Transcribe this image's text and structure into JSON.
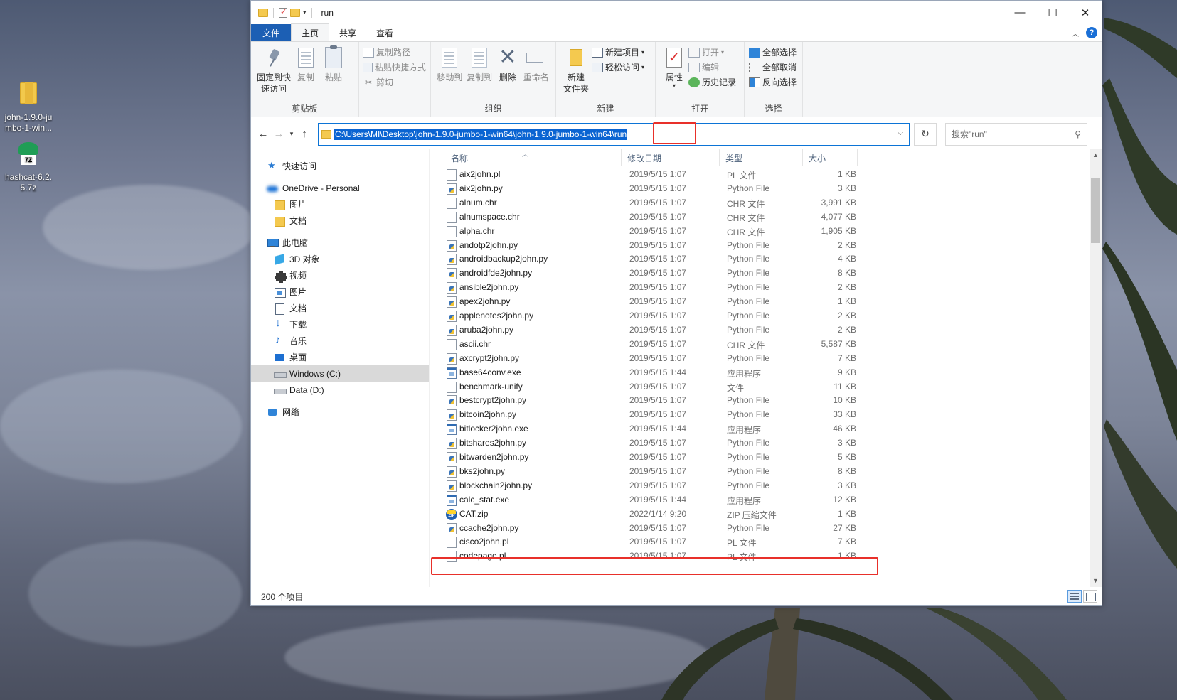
{
  "desktop": {
    "icons": [
      {
        "label": "john-1.9.0-jumbo-1-win...",
        "label_display": "john-1.9.0-ju\nmbo-1-win...",
        "icon": "folder-zip-icon"
      },
      {
        "label": "hashcat-6.2.5.7z",
        "label_display": "hashcat-6.2.\n5.7z",
        "icon": "7z-archive-icon"
      }
    ]
  },
  "window": {
    "title": "run",
    "controls": {
      "minimize": "—",
      "maximize": "☐",
      "close": "✕"
    }
  },
  "tabs": [
    {
      "label": "文件",
      "kind": "file"
    },
    {
      "label": "主页",
      "kind": "active"
    },
    {
      "label": "共享",
      "kind": "normal"
    },
    {
      "label": "查看",
      "kind": "normal"
    }
  ],
  "ribbon": {
    "clipboard": {
      "label": "剪贴板",
      "pin": "固定到快\n速访问",
      "copy": "复制",
      "paste": "粘贴",
      "copy_path": "复制路径",
      "paste_shortcut": "粘贴快捷方式",
      "cut": "剪切"
    },
    "organize": {
      "label": "组织",
      "move_to": "移动到",
      "copy_to": "复制到",
      "delete": "删除",
      "rename": "重命名"
    },
    "new": {
      "label": "新建",
      "new_folder": "新建\n文件夹",
      "new_item": "新建项目",
      "easy_access": "轻松访问"
    },
    "open": {
      "label": "打开",
      "properties": "属性",
      "open": "打开",
      "edit": "编辑",
      "history": "历史记录"
    },
    "select": {
      "label": "选择",
      "select_all": "全部选择",
      "select_none": "全部取消",
      "invert": "反向选择"
    }
  },
  "address": {
    "path_selected": "C:\\Users\\MI\\Desktop\\john-1.9.0-jumbo-1-win64\\john-1.9.0-jumbo-1-win64\\run",
    "search_placeholder": "搜索\"run\""
  },
  "navpane": {
    "items": [
      {
        "label": "快速访问",
        "icon": "star-icon",
        "indent": 0,
        "caret": ""
      },
      {
        "label": "OneDrive - Personal",
        "icon": "onedrive-icon",
        "indent": 0,
        "caret": ""
      },
      {
        "label": "图片",
        "icon": "folder-icon",
        "indent": 1,
        "caret": ""
      },
      {
        "label": "文档",
        "icon": "folder-icon",
        "indent": 1,
        "caret": ""
      },
      {
        "label": "此电脑",
        "icon": "this-pc-icon",
        "indent": 0,
        "caret": ""
      },
      {
        "label": "3D 对象",
        "icon": "3d-objects-icon",
        "indent": 1,
        "caret": ""
      },
      {
        "label": "视频",
        "icon": "videos-icon",
        "indent": 1,
        "caret": ""
      },
      {
        "label": "图片",
        "icon": "pictures-icon",
        "indent": 1,
        "caret": ""
      },
      {
        "label": "文档",
        "icon": "documents-icon",
        "indent": 1,
        "caret": ""
      },
      {
        "label": "下载",
        "icon": "downloads-icon",
        "indent": 1,
        "caret": ""
      },
      {
        "label": "音乐",
        "icon": "music-icon",
        "indent": 1,
        "caret": ""
      },
      {
        "label": "桌面",
        "icon": "desktop-icon",
        "indent": 1,
        "caret": ""
      },
      {
        "label": "Windows (C:)",
        "icon": "windows-drive-icon",
        "indent": 1,
        "caret": "",
        "selected": true
      },
      {
        "label": "Data (D:)",
        "icon": "drive-icon",
        "indent": 1,
        "caret": ""
      },
      {
        "label": "网络",
        "icon": "network-icon",
        "indent": 0,
        "caret": ""
      }
    ]
  },
  "columns": {
    "name": "名称",
    "date": "修改日期",
    "type": "类型",
    "size": "大小"
  },
  "files": [
    {
      "name": "aix2john.pl",
      "date": "2019/5/15 1:07",
      "type": "PL 文件",
      "size": "1 KB",
      "kind": "generic"
    },
    {
      "name": "aix2john.py",
      "date": "2019/5/15 1:07",
      "type": "Python File",
      "size": "3 KB",
      "kind": "py"
    },
    {
      "name": "alnum.chr",
      "date": "2019/5/15 1:07",
      "type": "CHR 文件",
      "size": "3,991 KB",
      "kind": "generic"
    },
    {
      "name": "alnumspace.chr",
      "date": "2019/5/15 1:07",
      "type": "CHR 文件",
      "size": "4,077 KB",
      "kind": "generic"
    },
    {
      "name": "alpha.chr",
      "date": "2019/5/15 1:07",
      "type": "CHR 文件",
      "size": "1,905 KB",
      "kind": "generic"
    },
    {
      "name": "andotp2john.py",
      "date": "2019/5/15 1:07",
      "type": "Python File",
      "size": "2 KB",
      "kind": "py"
    },
    {
      "name": "androidbackup2john.py",
      "date": "2019/5/15 1:07",
      "type": "Python File",
      "size": "4 KB",
      "kind": "py"
    },
    {
      "name": "androidfde2john.py",
      "date": "2019/5/15 1:07",
      "type": "Python File",
      "size": "8 KB",
      "kind": "py"
    },
    {
      "name": "ansible2john.py",
      "date": "2019/5/15 1:07",
      "type": "Python File",
      "size": "2 KB",
      "kind": "py"
    },
    {
      "name": "apex2john.py",
      "date": "2019/5/15 1:07",
      "type": "Python File",
      "size": "1 KB",
      "kind": "py"
    },
    {
      "name": "applenotes2john.py",
      "date": "2019/5/15 1:07",
      "type": "Python File",
      "size": "2 KB",
      "kind": "py"
    },
    {
      "name": "aruba2john.py",
      "date": "2019/5/15 1:07",
      "type": "Python File",
      "size": "2 KB",
      "kind": "py"
    },
    {
      "name": "ascii.chr",
      "date": "2019/5/15 1:07",
      "type": "CHR 文件",
      "size": "5,587 KB",
      "kind": "generic"
    },
    {
      "name": "axcrypt2john.py",
      "date": "2019/5/15 1:07",
      "type": "Python File",
      "size": "7 KB",
      "kind": "py"
    },
    {
      "name": "base64conv.exe",
      "date": "2019/5/15 1:44",
      "type": "应用程序",
      "size": "9 KB",
      "kind": "exe"
    },
    {
      "name": "benchmark-unify",
      "date": "2019/5/15 1:07",
      "type": "文件",
      "size": "11 KB",
      "kind": "generic"
    },
    {
      "name": "bestcrypt2john.py",
      "date": "2019/5/15 1:07",
      "type": "Python File",
      "size": "10 KB",
      "kind": "py"
    },
    {
      "name": "bitcoin2john.py",
      "date": "2019/5/15 1:07",
      "type": "Python File",
      "size": "33 KB",
      "kind": "py"
    },
    {
      "name": "bitlocker2john.exe",
      "date": "2019/5/15 1:44",
      "type": "应用程序",
      "size": "46 KB",
      "kind": "exe"
    },
    {
      "name": "bitshares2john.py",
      "date": "2019/5/15 1:07",
      "type": "Python File",
      "size": "3 KB",
      "kind": "py"
    },
    {
      "name": "bitwarden2john.py",
      "date": "2019/5/15 1:07",
      "type": "Python File",
      "size": "5 KB",
      "kind": "py"
    },
    {
      "name": "bks2john.py",
      "date": "2019/5/15 1:07",
      "type": "Python File",
      "size": "8 KB",
      "kind": "py"
    },
    {
      "name": "blockchain2john.py",
      "date": "2019/5/15 1:07",
      "type": "Python File",
      "size": "3 KB",
      "kind": "py"
    },
    {
      "name": "calc_stat.exe",
      "date": "2019/5/15 1:44",
      "type": "应用程序",
      "size": "12 KB",
      "kind": "exe"
    },
    {
      "name": "CAT.zip",
      "date": "2022/1/14 9:20",
      "type": "ZIP 压缩文件",
      "size": "1 KB",
      "kind": "zip",
      "highlighted": true
    },
    {
      "name": "ccache2john.py",
      "date": "2019/5/15 1:07",
      "type": "Python File",
      "size": "27 KB",
      "kind": "py"
    },
    {
      "name": "cisco2john.pl",
      "date": "2019/5/15 1:07",
      "type": "PL 文件",
      "size": "7 KB",
      "kind": "generic"
    },
    {
      "name": "codepage.pl",
      "date": "2019/5/15 1:07",
      "type": "PL 文件",
      "size": "1 KB",
      "kind": "generic"
    }
  ],
  "status": {
    "count": "200 个项目"
  },
  "colors": {
    "accent": "#0a64d2",
    "file_tab": "#1c5fb4",
    "highlight_box": "#e8302a"
  }
}
